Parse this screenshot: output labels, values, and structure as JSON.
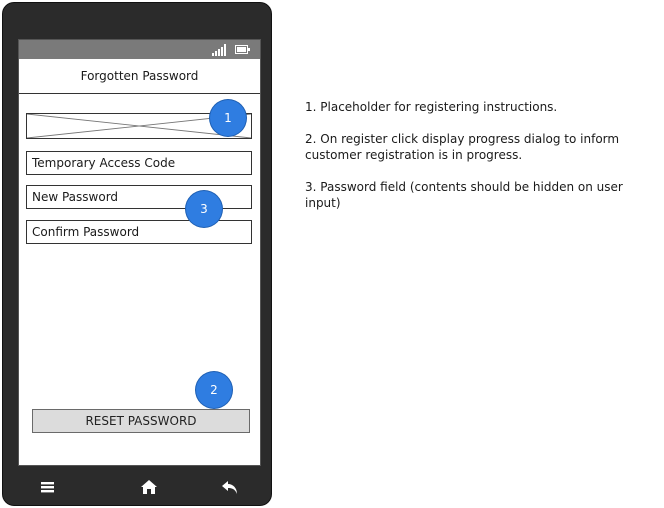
{
  "screen": {
    "title": "Forgotten Password",
    "fields": {
      "access_code": "Temporary Access Code",
      "new_password": "New Password",
      "confirm_password": "Confirm Password"
    },
    "reset_button": "RESET PASSWORD"
  },
  "badges": {
    "one": "1",
    "two": "2",
    "three": "3"
  },
  "notes": [
    "1. Placeholder for registering instructions.",
    "2. On register click display progress dialog to inform customer registration is in progress.",
    "3. Password field (contents should be hidden on user input)"
  ],
  "nav": {
    "icons": [
      "menu-icon",
      "home-icon",
      "back-icon"
    ]
  },
  "status_icons": [
    "signal-icon",
    "battery-icon"
  ],
  "colors": {
    "badge": "#2f7de1",
    "phone_body": "#2b2b2b",
    "status_bar": "#7a7a7a",
    "button": "#dcdcdc"
  }
}
